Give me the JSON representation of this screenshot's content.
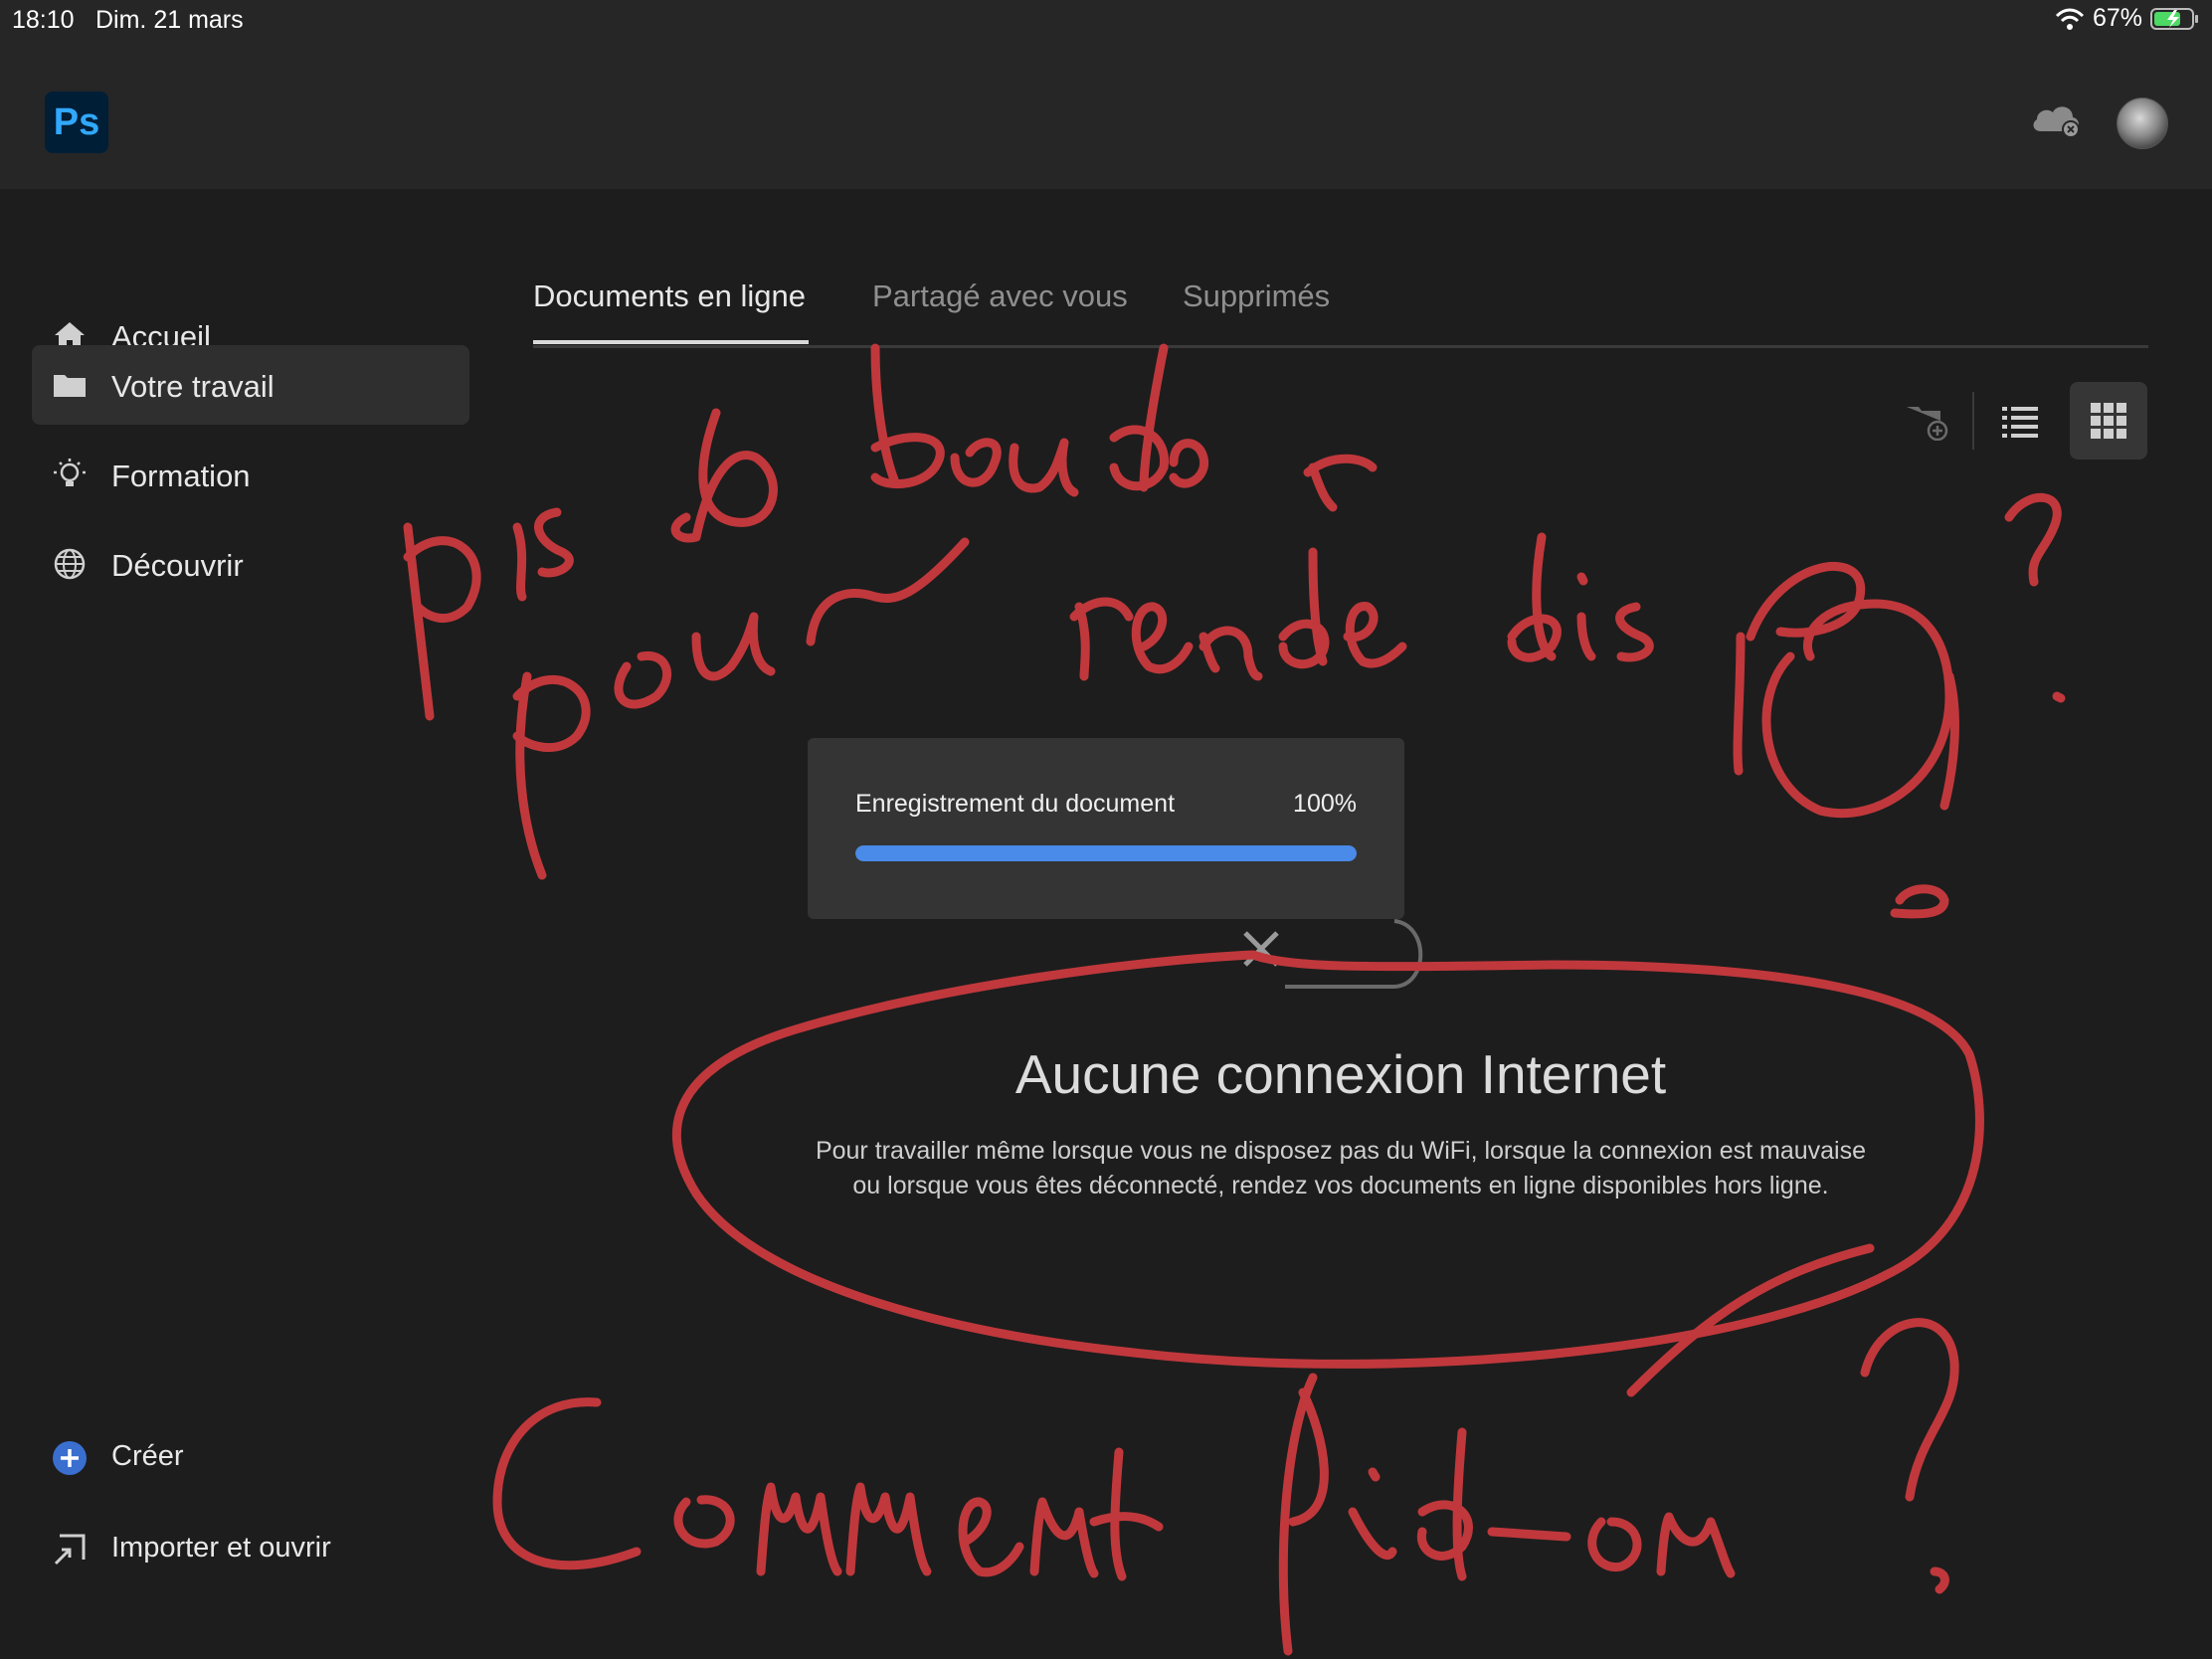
{
  "status_bar": {
    "time": "18:10",
    "date": "Dim. 21 mars",
    "battery_percent": "67%",
    "icons": [
      "wifi-icon",
      "battery-charging-icon"
    ]
  },
  "header": {
    "logo_text": "Ps",
    "icons": [
      "cloud-offline-icon",
      "avatar"
    ]
  },
  "sidebar": {
    "items": [
      {
        "label": "Accueil",
        "icon": "home-icon"
      },
      {
        "label": "Votre travail",
        "icon": "folder-icon",
        "active": true
      },
      {
        "label": "Formation",
        "icon": "lightbulb-icon"
      },
      {
        "label": "Découvrir",
        "icon": "globe-icon"
      }
    ],
    "bottom_items": [
      {
        "label": "Créer",
        "icon": "plus-circle-icon"
      },
      {
        "label": "Importer et ouvrir",
        "icon": "import-icon"
      }
    ]
  },
  "tabs": [
    {
      "label": "Documents en ligne",
      "active": true
    },
    {
      "label": "Partagé avec vous"
    },
    {
      "label": "Supprimés"
    }
  ],
  "toolbar": {
    "icons": [
      "new-folder-icon",
      "list-view-icon",
      "grid-view-icon"
    ],
    "selected": "grid-view-icon"
  },
  "progress_dialog": {
    "label": "Enregistrement du document",
    "percent_label": "100%",
    "progress": 1.0
  },
  "empty_state": {
    "title": "Aucune connexion Internet",
    "description_line1": "Pour travailler même lorsque vous ne disposez pas du WiFi, lorsque la connexion est mauvaise",
    "description_line2": "ou lorsque vous êtes déconnecté, rendez vos documents en ligne disponibles hors ligne."
  },
  "colors": {
    "background": "#1d1d1d",
    "header": "#262626",
    "accent_blue": "#4a8ae8",
    "annotation_red": "#c0383c"
  }
}
